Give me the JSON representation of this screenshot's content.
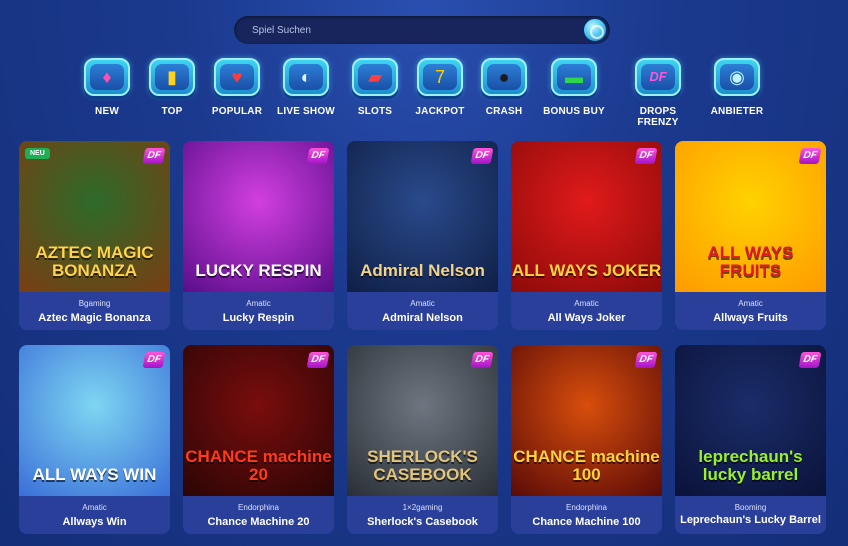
{
  "search": {
    "placeholder": "Spiel Suchen"
  },
  "categories": [
    {
      "label": "NEW",
      "icon": "gem-icon",
      "glyph": "♦",
      "color": "#ff4fb5"
    },
    {
      "label": "TOP",
      "icon": "bars-icon",
      "glyph": "▮",
      "color": "#ffd21f"
    },
    {
      "label": "POPULAR",
      "icon": "heart-icon",
      "glyph": "♥",
      "color": "#ff3b3b"
    },
    {
      "label": "LIVE SHOW",
      "icon": "mic-icon",
      "glyph": "◐",
      "color": "#dff4ff"
    },
    {
      "label": "SLOTS",
      "icon": "slot-reel-icon",
      "glyph": "▰",
      "color": "#ff4040"
    },
    {
      "label": "JACKPOT",
      "icon": "seven-icon",
      "glyph": "7",
      "color": "#ffcc00"
    },
    {
      "label": "CRASH",
      "icon": "bomb-icon",
      "glyph": "●",
      "color": "#1b1b1b"
    },
    {
      "label": "BONUS BUY",
      "icon": "cash-icon",
      "glyph": "▬",
      "color": "#2fd64b"
    },
    {
      "label": "DROPS FRENZY",
      "icon": "df-logo-icon",
      "glyph": "DF",
      "color": "#ff54d8"
    },
    {
      "label": "ANBIETER",
      "icon": "provider-robot-icon",
      "glyph": "◉",
      "color": "#bdf4ff"
    }
  ],
  "games": [
    {
      "name": "Aztec Magic Bonanza",
      "provider": "Bgaming",
      "badge": "NEU",
      "df": "DF",
      "art": "AZTEC MAGIC BONANZA",
      "bg": "#2d6b2a",
      "bg2": "#7a3d12",
      "fg": "#ffd34a"
    },
    {
      "name": "Lucky Respin",
      "provider": "Amatic",
      "df": "DF",
      "art": "LUCKY RESPIN",
      "bg": "#d23fe0",
      "bg2": "#5a0d8a",
      "fg": "#fff"
    },
    {
      "name": "Admiral Nelson",
      "provider": "Amatic",
      "df": "DF",
      "art": "Admiral Nelson",
      "bg": "#2a4a8c",
      "bg2": "#0f1f45",
      "fg": "#f1d48a"
    },
    {
      "name": "All Ways Joker",
      "provider": "Amatic",
      "df": "DF",
      "art": "ALL WAYS JOKER",
      "bg": "#e11a1a",
      "bg2": "#8c0a0a",
      "fg": "#ffd43b"
    },
    {
      "name": "Allways Fruits",
      "provider": "Amatic",
      "df": "DF",
      "art": "ALL WAYS FRUITS",
      "bg": "#ffd200",
      "bg2": "#ff9a00",
      "fg": "#e3162b"
    },
    {
      "name": "Allways Win",
      "provider": "Amatic",
      "df": "DF",
      "art": "ALL WAYS WIN",
      "bg": "#7ed6f2",
      "bg2": "#3a6fd8",
      "fg": "#fff"
    },
    {
      "name": "Chance Machine 20",
      "provider": "Endorphina",
      "df": "DF",
      "art": "CHANCE machine 20",
      "bg": "#7a0d0d",
      "bg2": "#2b0505",
      "fg": "#ff3b1a"
    },
    {
      "name": "Sherlock's Casebook",
      "provider": "1×2gaming",
      "df": "DF",
      "art": "SHERLOCK'S CASEBOOK",
      "bg": "#6d7680",
      "bg2": "#2a2f36",
      "fg": "#e2c47a"
    },
    {
      "name": "Chance Machine 100",
      "provider": "Endorphina",
      "df": "DF",
      "art": "CHANCE machine 100",
      "bg": "#d84e0c",
      "bg2": "#5a0a08",
      "fg": "#ffd23b"
    },
    {
      "name": "Leprechaun's Lucky Barrel",
      "provider": "Booming",
      "df": "DF",
      "art": "leprechaun's lucky barrel",
      "bg": "#1a2d6a",
      "bg2": "#0b1238",
      "fg": "#9af02a"
    }
  ]
}
